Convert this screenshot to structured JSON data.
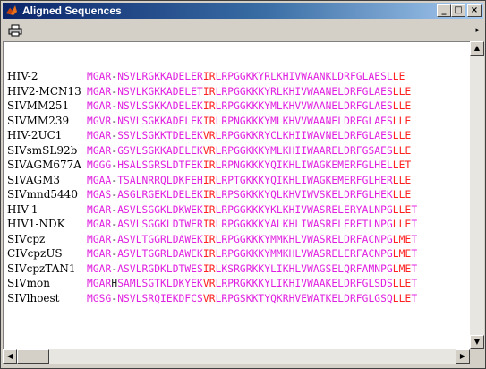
{
  "window": {
    "title": "Aligned Sequences",
    "minimize_label": "_",
    "maximize_label": "□",
    "close_label": "×",
    "icon": "matlab-icon"
  },
  "toolbar": {
    "print_icon": "printer-icon",
    "overflow_icon": "chevron-right-icon"
  },
  "colors": {
    "match": "#e020e0",
    "partial": "#ff2020",
    "other": "#1a1a1a",
    "title_bar_start": "#0a246a",
    "title_bar_end": "#a6caf0"
  },
  "sequences": [
    {
      "name": "HIV-2",
      "seq": "MGAR-NSVLRGKKADELERIRLRPGGKKYRLKHIVWAANKLDRFGLAESLLE",
      "colors": "mmmmbmmmmmmmmmmmmmmrrmmmmmmmmmmmmmmmmmmmmmmmmmmmmmrrr"
    },
    {
      "name": "HIV2-MCN13",
      "seq": "MGAR-NSVLKGKKADELETIRLRPGGKKKYRLKHIVWAANELDRFGLAESLLE",
      "colors": "mmmmbmmmmmmmmmmmmmmrrmmmmmmmmmmmmmmmmmmmmmmmmmmmmmrrr"
    },
    {
      "name": "SIVMM251",
      "seq": "MGAR-NSVLSGKKADELEKIRLRPGGKKKYMLKHVVWAANELDRFGLAESLLE",
      "colors": "mmmmbmmmmmmmmmmmmmmrrmmmmmmmmmmmmmmmmmmmmmmmmmmmmmrrr"
    },
    {
      "name": "SIVMM239",
      "seq": "MGVR-NSVLSGKKADELEKIRLRPNGKKKYMLKHVVWAANELDRFGLAESLLE",
      "colors": "mmmmbmmmmmmmmmmmmmmrrmmmmmmmmmmmmmmmmmmmmmmmmmmmmmrrr"
    },
    {
      "name": "HIV-2UC1",
      "seq": "MGAR-SSVLSGKKTDELEKVRLRPGGKKRYCLKHIIWAVNELDRFGLAESLLE",
      "colors": "mmmmbmmmmmmmmmmmmmmrrmmmmmmmmmmmmmmmmmmmmmmmmmmmmmrrr"
    },
    {
      "name": "SIVsmSL92b",
      "seq": "MGAR-GSVLSGKKADELEKVRLRPGGKKKYMLKHIIWAARELDRFGSAESLLE",
      "colors": "mmmmbmmmmmmmmmmmmmmrrmmmmmmmmmmmmmmmmmmmmmmmmmmmmmrrr"
    },
    {
      "name": "SIVAGM677A",
      "seq": "MGGG-HSALSGRSLDTFEKIRLRPNGKKKYQIKHLIWAGKEMERFGLHELLET",
      "colors": "mmmmbmmmmmmmmmmmmmmrrmmmmmmmmmmmmmmmmmmmmmmmmmmmmmrrr"
    },
    {
      "name": "SIVAGM3",
      "seq": "MGAA-TSALNRRQLDKFEHIRLRPTGKKKYQIKHLIWAGKEMERFGLHERLLE",
      "colors": "mmmmbmmmmmmmmmmmmmmrrmmmmmmmmmmmmmmmmmmmmmmmmmmmmmrrr"
    },
    {
      "name": "SIVmnd5440",
      "seq": "MGAS-ASGLRGEKLDELEKIRLRPSGKKKYQLKHVIWVSKELDRFGLHEKLLE",
      "colors": "mmmmbmmmmmmmmmmmmmmrrmmmmmmmmmmmmmmmmmmmmmmmmmmmmmrrr"
    },
    {
      "name": "HIV-1",
      "seq": "MGAR-ASVLSGGKLDKWEKIRLRPGGKKKYKLKHIVWASRELERYALNPGLLET",
      "colors": "mmmmbmmmmmmmmmmmmmmrrmmmmmmmmmmmmmmmmmmmmmmmmmmmmmrrr"
    },
    {
      "name": "HIV1-NDK",
      "seq": "MGAR-ASVLSGGKLDTWERIRLRPGGKKKYALKHLIWASRELERFTLNPGLLET",
      "colors": "mmmmbmmmmmmmmmmmmmmrrmmmmmmmmmmmmmmmmmmmmmmmmmmmmmrrr"
    },
    {
      "name": "SIVcpz",
      "seq": "MGAR-ASVLTGGRLDAWEKIRLRPGGKKKYMMKHLVWASRELDRFACNPGLMET",
      "colors": "mmmmbmmmmmmmmmmmmmmrrmmmmmmmmmmmmmmmmmmmmmmmmmmmmmrrr"
    },
    {
      "name": "CIVcpzUS",
      "seq": "MGAR-ASVLTGGRLDAWEKIRLRPGGKKKYMMKHLVWASRELERFACNPGLMET",
      "colors": "mmmmbmmmmmmmmmmmmmmrrmmmmmmmmmmmmmmmmmmmmmmmmmmmmmrrr"
    },
    {
      "name": "SIVcpzTAN1",
      "seq": "MGAR-ASVLRGDKLDTWESIRLKSRGRKKYLIKHLVWAGSELQRFAMNPGLMET",
      "colors": "mmmmbmmmmmmmmmmmmmmrrmmmmmmmmmmmmmmmmmmmmmmmmmmmmmrrr"
    },
    {
      "name": "SIVmon",
      "seq": "MGARHSAMLSGTKLDKYEKVRLRPRGKKKYLIKHIVWAAKELDRFGLSDSLLET",
      "colors": "mmmmbmmmmmmmmmmmmmmrrmmmmmmmmmmmmmmmmmmmmmmmmmmmmmrrr"
    },
    {
      "name": "SIVlhoest",
      "seq": "MGSG-NSVLSRQIEKDFCSVRLRPGSKKTYQKRHVEWATKELDRFGLGSQLLET",
      "colors": "mmmmbmmmmmmmmmmmmmmrrmmmmmmmmmmmmmmmmmmmmmmmmmmmmmrrr"
    }
  ],
  "scrollbars": {
    "up_icon": "arrow-up-icon",
    "down_icon": "arrow-down-icon",
    "left_icon": "arrow-left-icon",
    "right_icon": "arrow-right-icon"
  }
}
